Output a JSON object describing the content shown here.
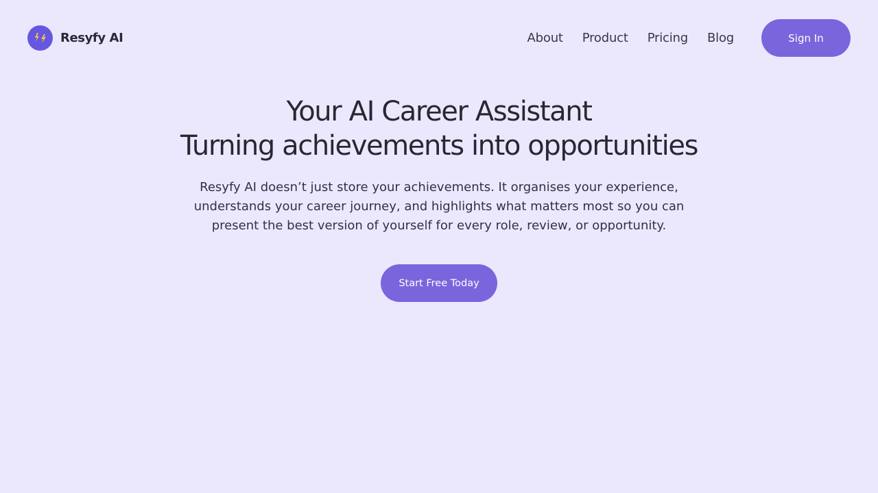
{
  "brand": {
    "name": "Resyfy AI",
    "logo_icon": "lightning-bolts-icon",
    "logo_color": "#6657e0",
    "bolt_color": "#f4bf4f"
  },
  "nav": {
    "items": [
      {
        "label": "About"
      },
      {
        "label": "Product"
      },
      {
        "label": "Pricing"
      },
      {
        "label": "Blog"
      }
    ],
    "sign_in_label": "Sign In"
  },
  "hero": {
    "title_line1": "Your AI Career Assistant",
    "title_line2": "Turning achievements into opportunities",
    "description": "Resyfy AI doesn’t just store your achievements. It organises your experience, understands your career journey, and highlights what matters most so you can present the best version of yourself for every role, review, or opportunity.",
    "cta_label": "Start Free Today"
  },
  "colors": {
    "background": "#ebe8fe",
    "accent": "#7b65dd",
    "text": "#2b2633"
  }
}
